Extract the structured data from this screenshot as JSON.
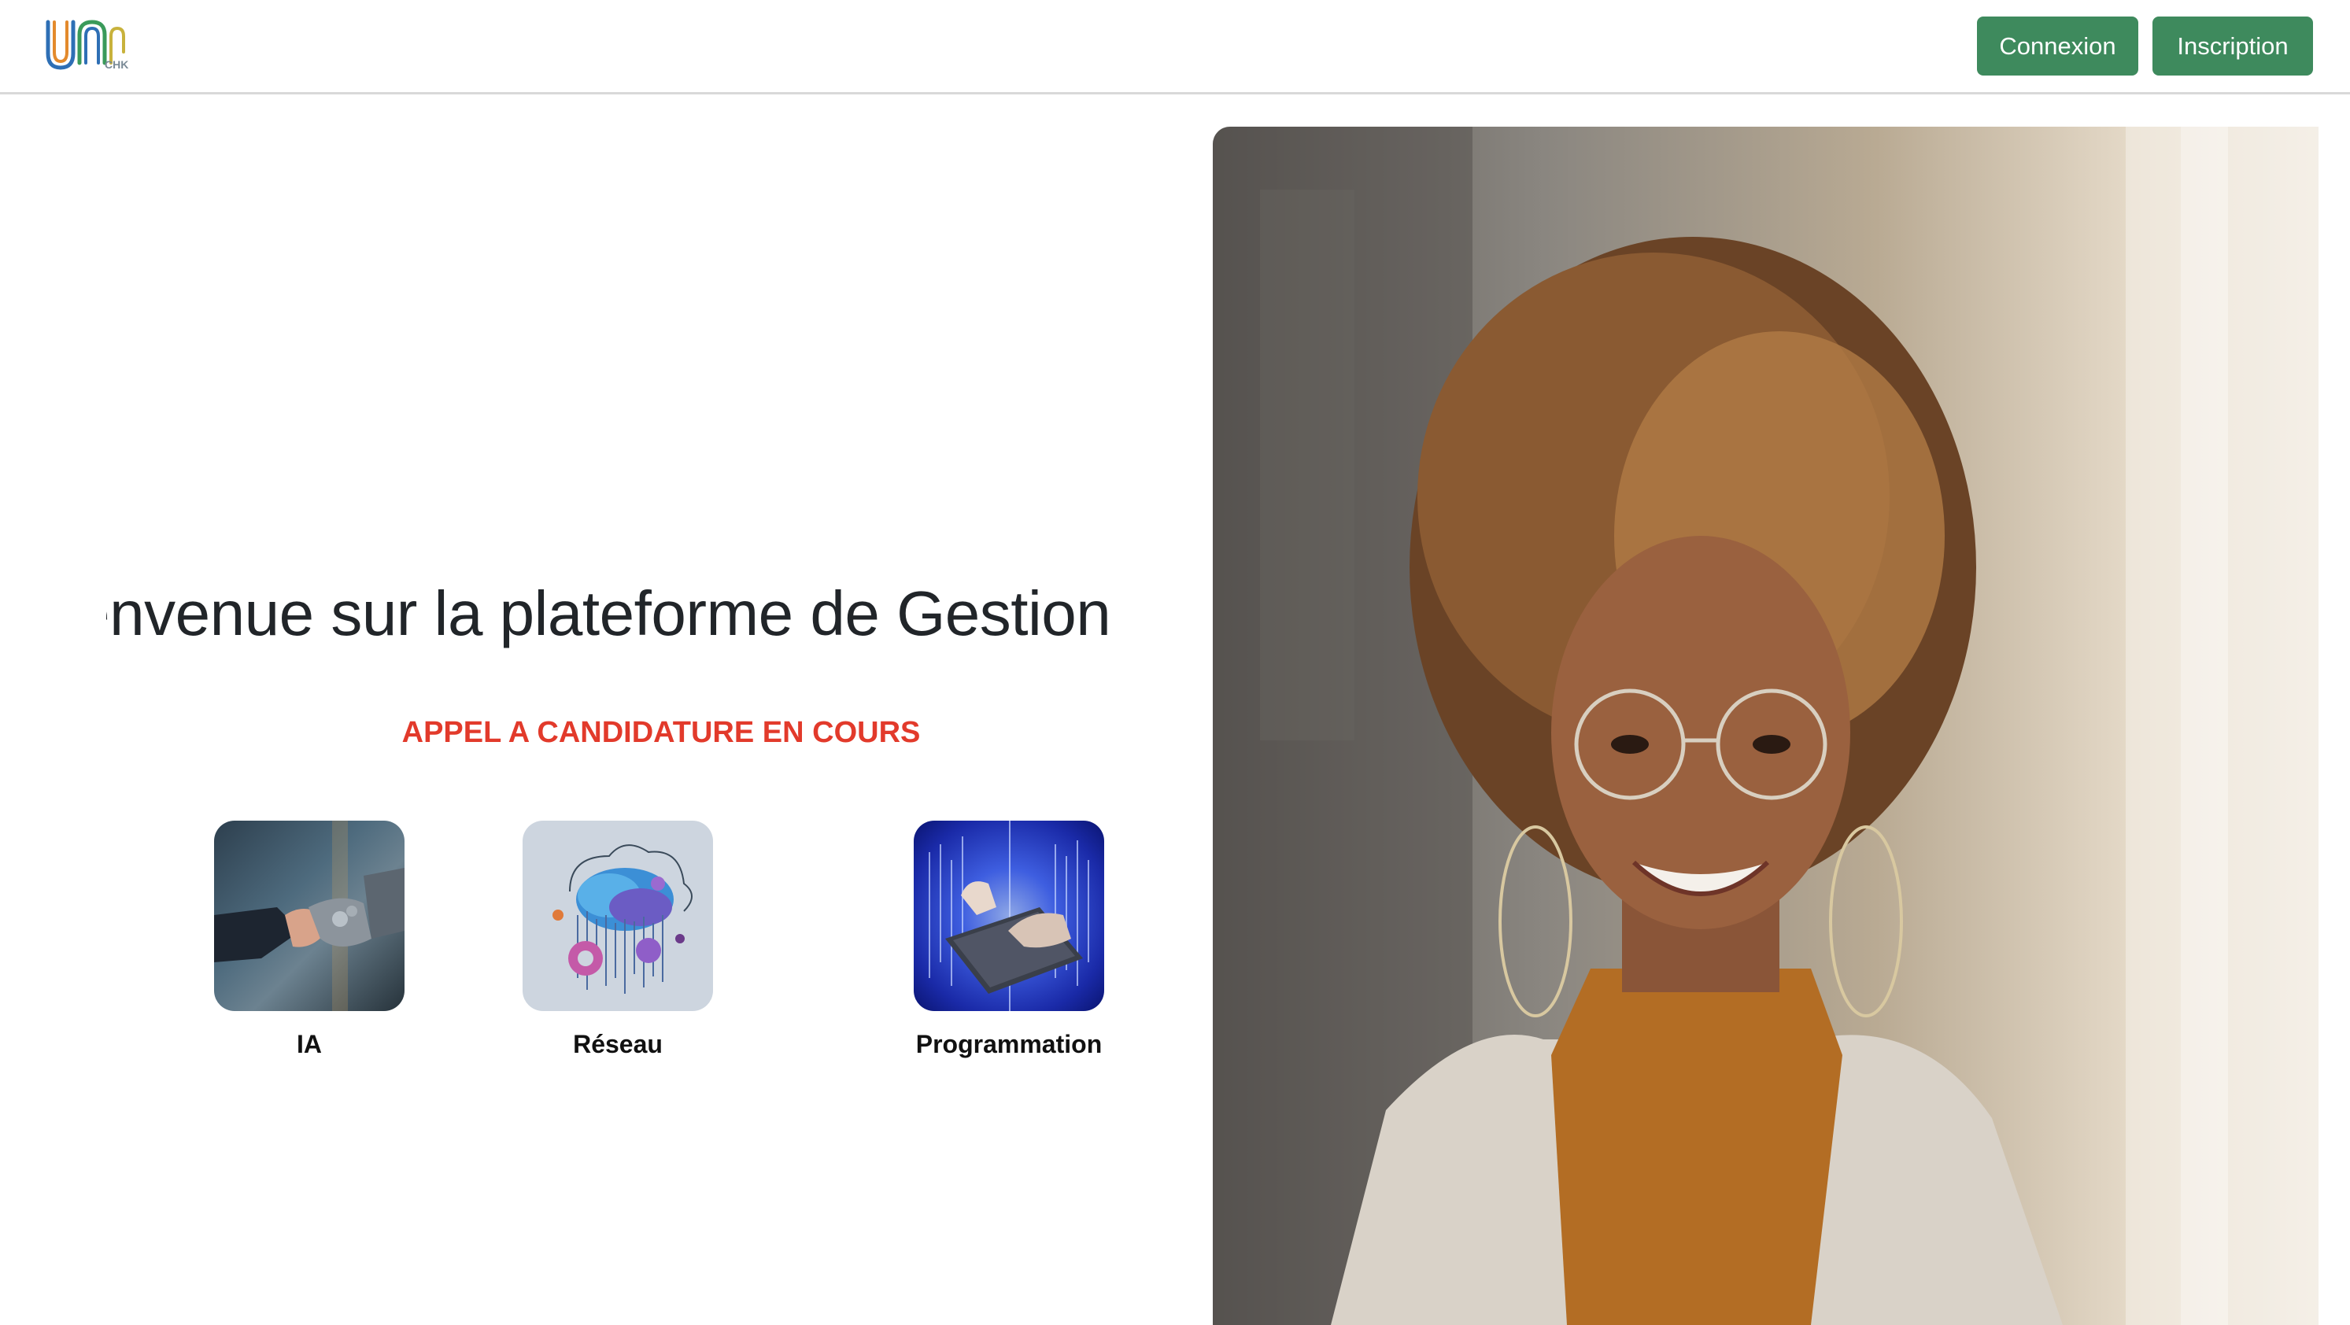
{
  "header": {
    "logo_text": "CHK",
    "login_label": "Connexion",
    "signup_label": "Inscription"
  },
  "hero": {
    "welcome_text": "Bienvenue sur la plateforme de Gestion des",
    "call_text": "APPEL A CANDIDATURE EN COURS"
  },
  "domains": [
    {
      "label": "IA"
    },
    {
      "label": "Réseau"
    },
    {
      "label": "Programmation"
    }
  ],
  "colors": {
    "button_green": "#3e8a5d",
    "call_red": "#e23a2b"
  }
}
